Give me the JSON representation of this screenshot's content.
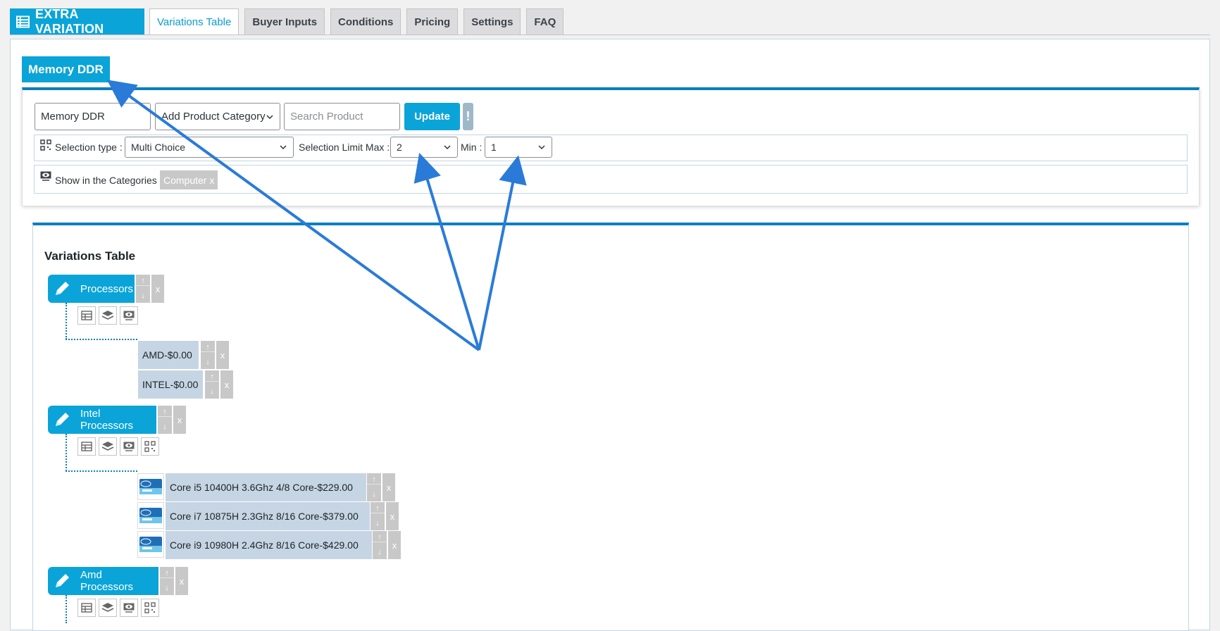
{
  "brand": {
    "title": "EXTRA VARIATION"
  },
  "tabs": [
    {
      "label": "Variations Table",
      "active": true
    },
    {
      "label": "Buyer Inputs"
    },
    {
      "label": "Conditions"
    },
    {
      "label": "Pricing"
    },
    {
      "label": "Settings"
    },
    {
      "label": "FAQ"
    }
  ],
  "group": {
    "title": "Memory DDR",
    "name_value": "Memory DDR",
    "category_select": "Add Product Category",
    "search_placeholder": "Search Product",
    "update_label": "Update",
    "warn_label": "!",
    "selection_type_label": "Selection type :",
    "selection_type_value": "Multi Choice",
    "limit_max_label": "Selection Limit Max :",
    "limit_max_value": "2",
    "min_label": "Min :",
    "min_value": "1",
    "show_in_categories_label": "Show in the Categories :",
    "category_chip": "Computer x"
  },
  "variations_table": {
    "title": "Variations Table",
    "up": "↑",
    "down": "↓",
    "remove": "x",
    "nodes": [
      {
        "label": "Processors",
        "items": [
          {
            "label": "AMD-$0.00"
          },
          {
            "label": "INTEL-$0.00"
          }
        ]
      },
      {
        "label": "Intel Processors",
        "items": [
          {
            "label": "Core i5 10400H 3.6Ghz 4/8 Core-$229.00"
          },
          {
            "label": "Core i7 10875H 2.3Ghz 8/16 Core-$379.00"
          },
          {
            "label": "Core i9 10980H 2.4Ghz 8/16 Core-$429.00"
          }
        ]
      },
      {
        "label": "Amd Processors",
        "items": []
      }
    ]
  },
  "colors": {
    "accent": "#0aa4d8",
    "accent_dark": "#0a7fbf",
    "item_bg": "#c6d5e3",
    "annotation_arrow": "#2a7bd8"
  }
}
